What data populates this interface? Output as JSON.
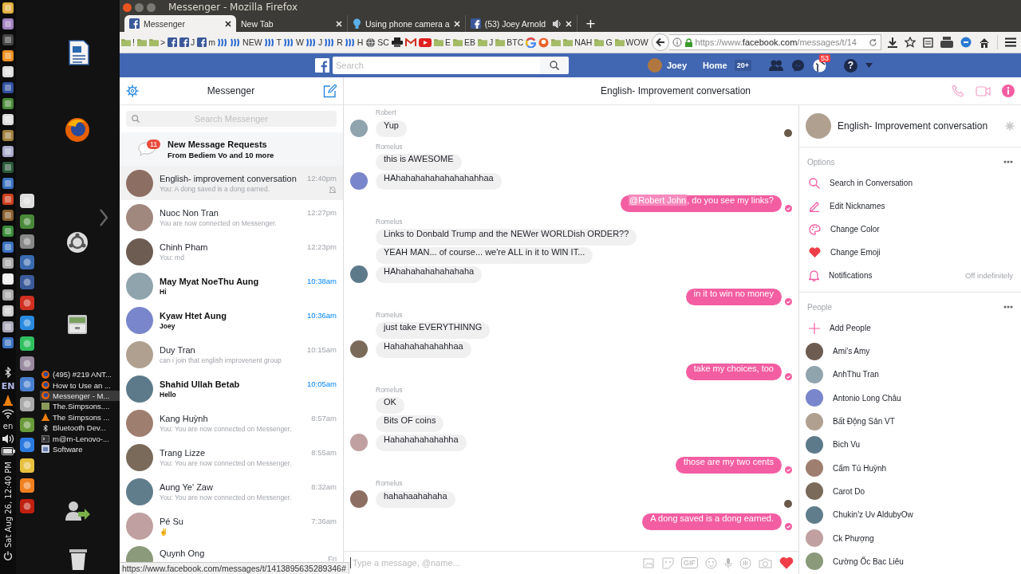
{
  "desktop": {
    "window_list": [
      {
        "title": "(495) #219 ANT...",
        "kind": "firefox",
        "selected": false
      },
      {
        "title": "How to Use an ...",
        "kind": "firefox",
        "selected": false
      },
      {
        "title": "Messenger - M...",
        "kind": "firefox",
        "selected": true
      },
      {
        "title": "The.Simpsons....",
        "kind": "folder",
        "selected": false
      },
      {
        "title": "The Simpsons ...",
        "kind": "vlc",
        "selected": false
      },
      {
        "title": "Bluetooth Dev...",
        "kind": "bluetooth",
        "selected": false
      },
      {
        "title": "m@m-Lenovo-...",
        "kind": "terminal",
        "selected": false
      },
      {
        "title": "Software",
        "kind": "software",
        "selected": false
      }
    ],
    "keyboard_layout": "EN",
    "language": "en",
    "clock": "Sat Aug 26, 12:40 PM"
  },
  "browser": {
    "title": "Messenger - Mozilla Firefox",
    "tabs": [
      {
        "label": "Messenger",
        "kind": "facebook",
        "selected": true,
        "audio": false
      },
      {
        "label": "New Tab",
        "kind": "blank",
        "selected": false,
        "audio": false
      },
      {
        "label": "Using phone camera a",
        "kind": "bulb",
        "selected": false,
        "audio": false
      },
      {
        "label": "(53) Joey Arnold",
        "kind": "facebook",
        "selected": false,
        "audio": true
      }
    ],
    "new_tab": "+",
    "bookmarks": [
      {
        "kind": "folder",
        "label": "!"
      },
      {
        "kind": "folder"
      },
      {
        "kind": "folder",
        "label": ">"
      },
      {
        "kind": "facebook"
      },
      {
        "kind": "facebook",
        "label": "J"
      },
      {
        "kind": "facebook",
        "label": "m"
      },
      {
        "kind": "steem"
      },
      {
        "kind": "steem",
        "label": "NEW"
      },
      {
        "kind": "steem",
        "label": "T"
      },
      {
        "kind": "steem",
        "label": "W"
      },
      {
        "kind": "steem",
        "label": "J"
      },
      {
        "kind": "steem",
        "label": "R"
      },
      {
        "kind": "steem",
        "label": "H"
      },
      {
        "kind": "globe",
        "label": "SC"
      },
      {
        "kind": "printer"
      },
      {
        "kind": "mail"
      },
      {
        "kind": "video"
      },
      {
        "kind": "folder",
        "label": "E"
      },
      {
        "kind": "folder",
        "label": "EB"
      },
      {
        "kind": "folder",
        "label": "J"
      },
      {
        "kind": "folder",
        "label": "BTC"
      },
      {
        "kind": "ring"
      },
      {
        "kind": "orange"
      },
      {
        "kind": "folder"
      },
      {
        "kind": "folder",
        "label": "NAH"
      },
      {
        "kind": "folder",
        "label": "G"
      },
      {
        "kind": "folder",
        "label": "WOW"
      }
    ],
    "url": {
      "prefix": "https://www.",
      "domain": "facebook.com",
      "path": "/messages/t/14"
    },
    "status_url": "https://www.facebook.com/messages/t/1413895635289346#"
  },
  "facebook_bar": {
    "search_placeholder": "Search",
    "user": "Joey",
    "home": "Home",
    "home_badge": "20+",
    "notifications_badge": "53",
    "help": "?"
  },
  "sidebar": {
    "title": "Messenger",
    "search_placeholder": "Search Messenger",
    "requests": {
      "title": "New Message Requests",
      "subtitle": "From Bediem Vo and 10 more",
      "badge": "11"
    },
    "conversations": [
      {
        "name": "English- improvement conversation",
        "preview": "You: A dong saved is a dong earned.",
        "time": "12:40pm",
        "selected": true,
        "unread": false,
        "muted": true
      },
      {
        "name": "Nuoc Non Tran",
        "preview": "You are now connected on Messenger.",
        "time": "12:27pm",
        "selected": false,
        "unread": false,
        "muted": false
      },
      {
        "name": "Chinh Pham",
        "preview": "You: md",
        "time": "12:23pm",
        "selected": false,
        "unread": false,
        "muted": false
      },
      {
        "name": "May Myat NoeThu Aung",
        "preview": "Hi",
        "time": "10:38am",
        "selected": false,
        "unread": true,
        "muted": false
      },
      {
        "name": "Kyaw Htet Aung",
        "preview": "Joey",
        "time": "10:36am",
        "selected": false,
        "unread": true,
        "muted": false
      },
      {
        "name": "Duy Tran",
        "preview": "can i join that english improvenent group",
        "time": "10:15am",
        "selected": false,
        "unread": false,
        "muted": false
      },
      {
        "name": "Shahid Ullah Betab",
        "preview": "Hello",
        "time": "10:05am",
        "selected": false,
        "unread": true,
        "muted": false
      },
      {
        "name": "Kang Huỳnh",
        "preview": "You: You are now connected on Messenger.",
        "time": "8:57am",
        "selected": false,
        "unread": false,
        "muted": false
      },
      {
        "name": "Trang Lizze",
        "preview": "You: You are now connected on Messenger.",
        "time": "8:55am",
        "selected": false,
        "unread": false,
        "muted": false
      },
      {
        "name": "Aung Ye' Zaw",
        "preview": "You: You are now connected on Messenger.",
        "time": "8:32am",
        "selected": false,
        "unread": false,
        "muted": false
      },
      {
        "name": "Pé Su",
        "preview": "✌",
        "time": "7:36am",
        "selected": false,
        "unread": false,
        "muted": false
      },
      {
        "name": "Quynh Ong",
        "time": "Fri",
        "selected": false,
        "unread": false,
        "muted": false
      }
    ]
  },
  "chat": {
    "title": "English- Improvement conversation",
    "groups": [
      {
        "kind": "incoming",
        "sender": "Robert",
        "messages": [
          {
            "text": "Yup"
          }
        ],
        "read_receipt": true
      },
      {
        "kind": "incoming",
        "sender": "Romelus",
        "messages": [
          {
            "text": "this is AWESOME"
          },
          {
            "text": "HAhahahahahahahahahhaa"
          }
        ]
      },
      {
        "kind": "outgoing",
        "messages": [
          {
            "mention": "@Robert John",
            "text": ", do you see my links?"
          }
        ],
        "delivered": true
      },
      {
        "kind": "incoming",
        "sender": "Romelus",
        "messages": [
          {
            "text": "Links to Donbald Trump and the NEWer WORLDish ORDER??"
          },
          {
            "text": "YEAH MAN... of course... we're ALL in it to WIN IT..."
          },
          {
            "text": "HAhahahahahahahaha"
          }
        ]
      },
      {
        "kind": "outgoing",
        "messages": [
          {
            "text": "in it to win no money"
          }
        ],
        "delivered": true
      },
      {
        "kind": "incoming",
        "sender": "Romelus",
        "messages": [
          {
            "text": "just take EVERYTHINNG"
          },
          {
            "text": "Hahahahahahahhaa"
          }
        ]
      },
      {
        "kind": "outgoing",
        "messages": [
          {
            "text": "take my choices, too"
          }
        ],
        "delivered": true
      },
      {
        "kind": "incoming",
        "sender": "Romelus",
        "messages": [
          {
            "text": "OK"
          },
          {
            "text": "Bits OF coins"
          },
          {
            "text": "Hahahahahahahha"
          }
        ]
      },
      {
        "kind": "outgoing",
        "messages": [
          {
            "text": "those are my two cents"
          }
        ],
        "delivered": true
      },
      {
        "kind": "incoming",
        "sender": "Romelus",
        "messages": [
          {
            "text": "hahahaahahaha"
          }
        ],
        "read_receipt": true
      },
      {
        "kind": "outgoing",
        "messages": [
          {
            "text": "A dong saved is a dong earned."
          }
        ],
        "delivered": true
      }
    ],
    "composer": {
      "placeholder": "Type a message, @name...",
      "gif": "GIF"
    }
  },
  "details": {
    "title": "English- Improvement conversation",
    "options": {
      "label": "Options",
      "items": [
        {
          "kind": "search",
          "label": "Search in Conversation"
        },
        {
          "kind": "nickname",
          "label": "Edit Nicknames"
        },
        {
          "kind": "color",
          "label": "Change Color"
        },
        {
          "kind": "emoji",
          "label": "Change Emoji"
        },
        {
          "kind": "notifications",
          "label": "Notifications",
          "value": "Off indefinitely"
        }
      ]
    },
    "people": {
      "label": "People",
      "add": "Add People",
      "members": [
        "Ami's Amy",
        "AnhThu Tran",
        "Antonio Long Châu",
        "Bất Động Sản VT",
        "Bich Vu",
        "Cẩm Tú Huỳnh",
        "Carot Do",
        "Chukin'z Uv AldubyOw",
        "Ck Phượng",
        "Cường Ốc Bac Liêu"
      ]
    }
  }
}
